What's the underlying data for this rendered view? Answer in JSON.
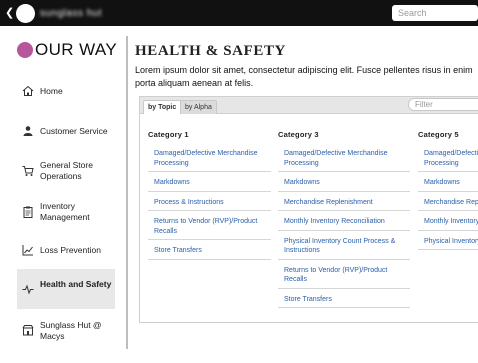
{
  "topbar": {
    "blurred_title": "sunglass hut",
    "search_placeholder": "Search"
  },
  "sidebar": {
    "logo_text": "OUR WAY",
    "items": [
      {
        "label": "Home",
        "icon": "home-icon"
      },
      {
        "label": "Customer Service",
        "icon": "person-icon"
      },
      {
        "label": "General Store Operations",
        "icon": "cart-icon"
      },
      {
        "label": "Inventory Management",
        "icon": "clipboard-icon"
      },
      {
        "label": "Loss Prevention",
        "icon": "chart-icon"
      },
      {
        "label": "Health and Safety",
        "icon": "pulse-icon",
        "active": true
      },
      {
        "label": "Sunglass Hut @ Macys",
        "icon": "store-icon"
      }
    ]
  },
  "main": {
    "title": "HEALTH & SAFETY",
    "intro": "Lorem ipsum dolor sit amet, consectetur adipiscing elit. Fusce pellentes risus in enim porta aliquam aenean at felis.",
    "tabs": [
      "by Topic",
      "by Alpha"
    ],
    "filter_placeholder": "Filter",
    "columns": [
      {
        "heading": "Category 1",
        "links": [
          "Damaged/Defective Merchandise Processing",
          "Markdowns",
          "Process & Instructions",
          "Returns to Vendor (RVP)/Product Recalls",
          "Store Transfers"
        ]
      },
      {
        "heading": "Category 3",
        "links": [
          "Damaged/Defective Merchandise Processing",
          "Markdowns",
          "Merchandise Replenishment",
          "Monthly Inventory Reconciliation",
          "Physical Inventory Count Process & Instructions",
          "Returns to Vendor (RVP)/Product Recalls",
          "Store Transfers"
        ]
      },
      {
        "heading": "Category 5",
        "links": [
          "Damaged/Defective Merchandise Processing",
          "Markdowns",
          "Merchandise Replenishment",
          "Monthly Inventory Reconciliation",
          "Physical Inventory Count Process & Instructions"
        ]
      }
    ]
  }
}
